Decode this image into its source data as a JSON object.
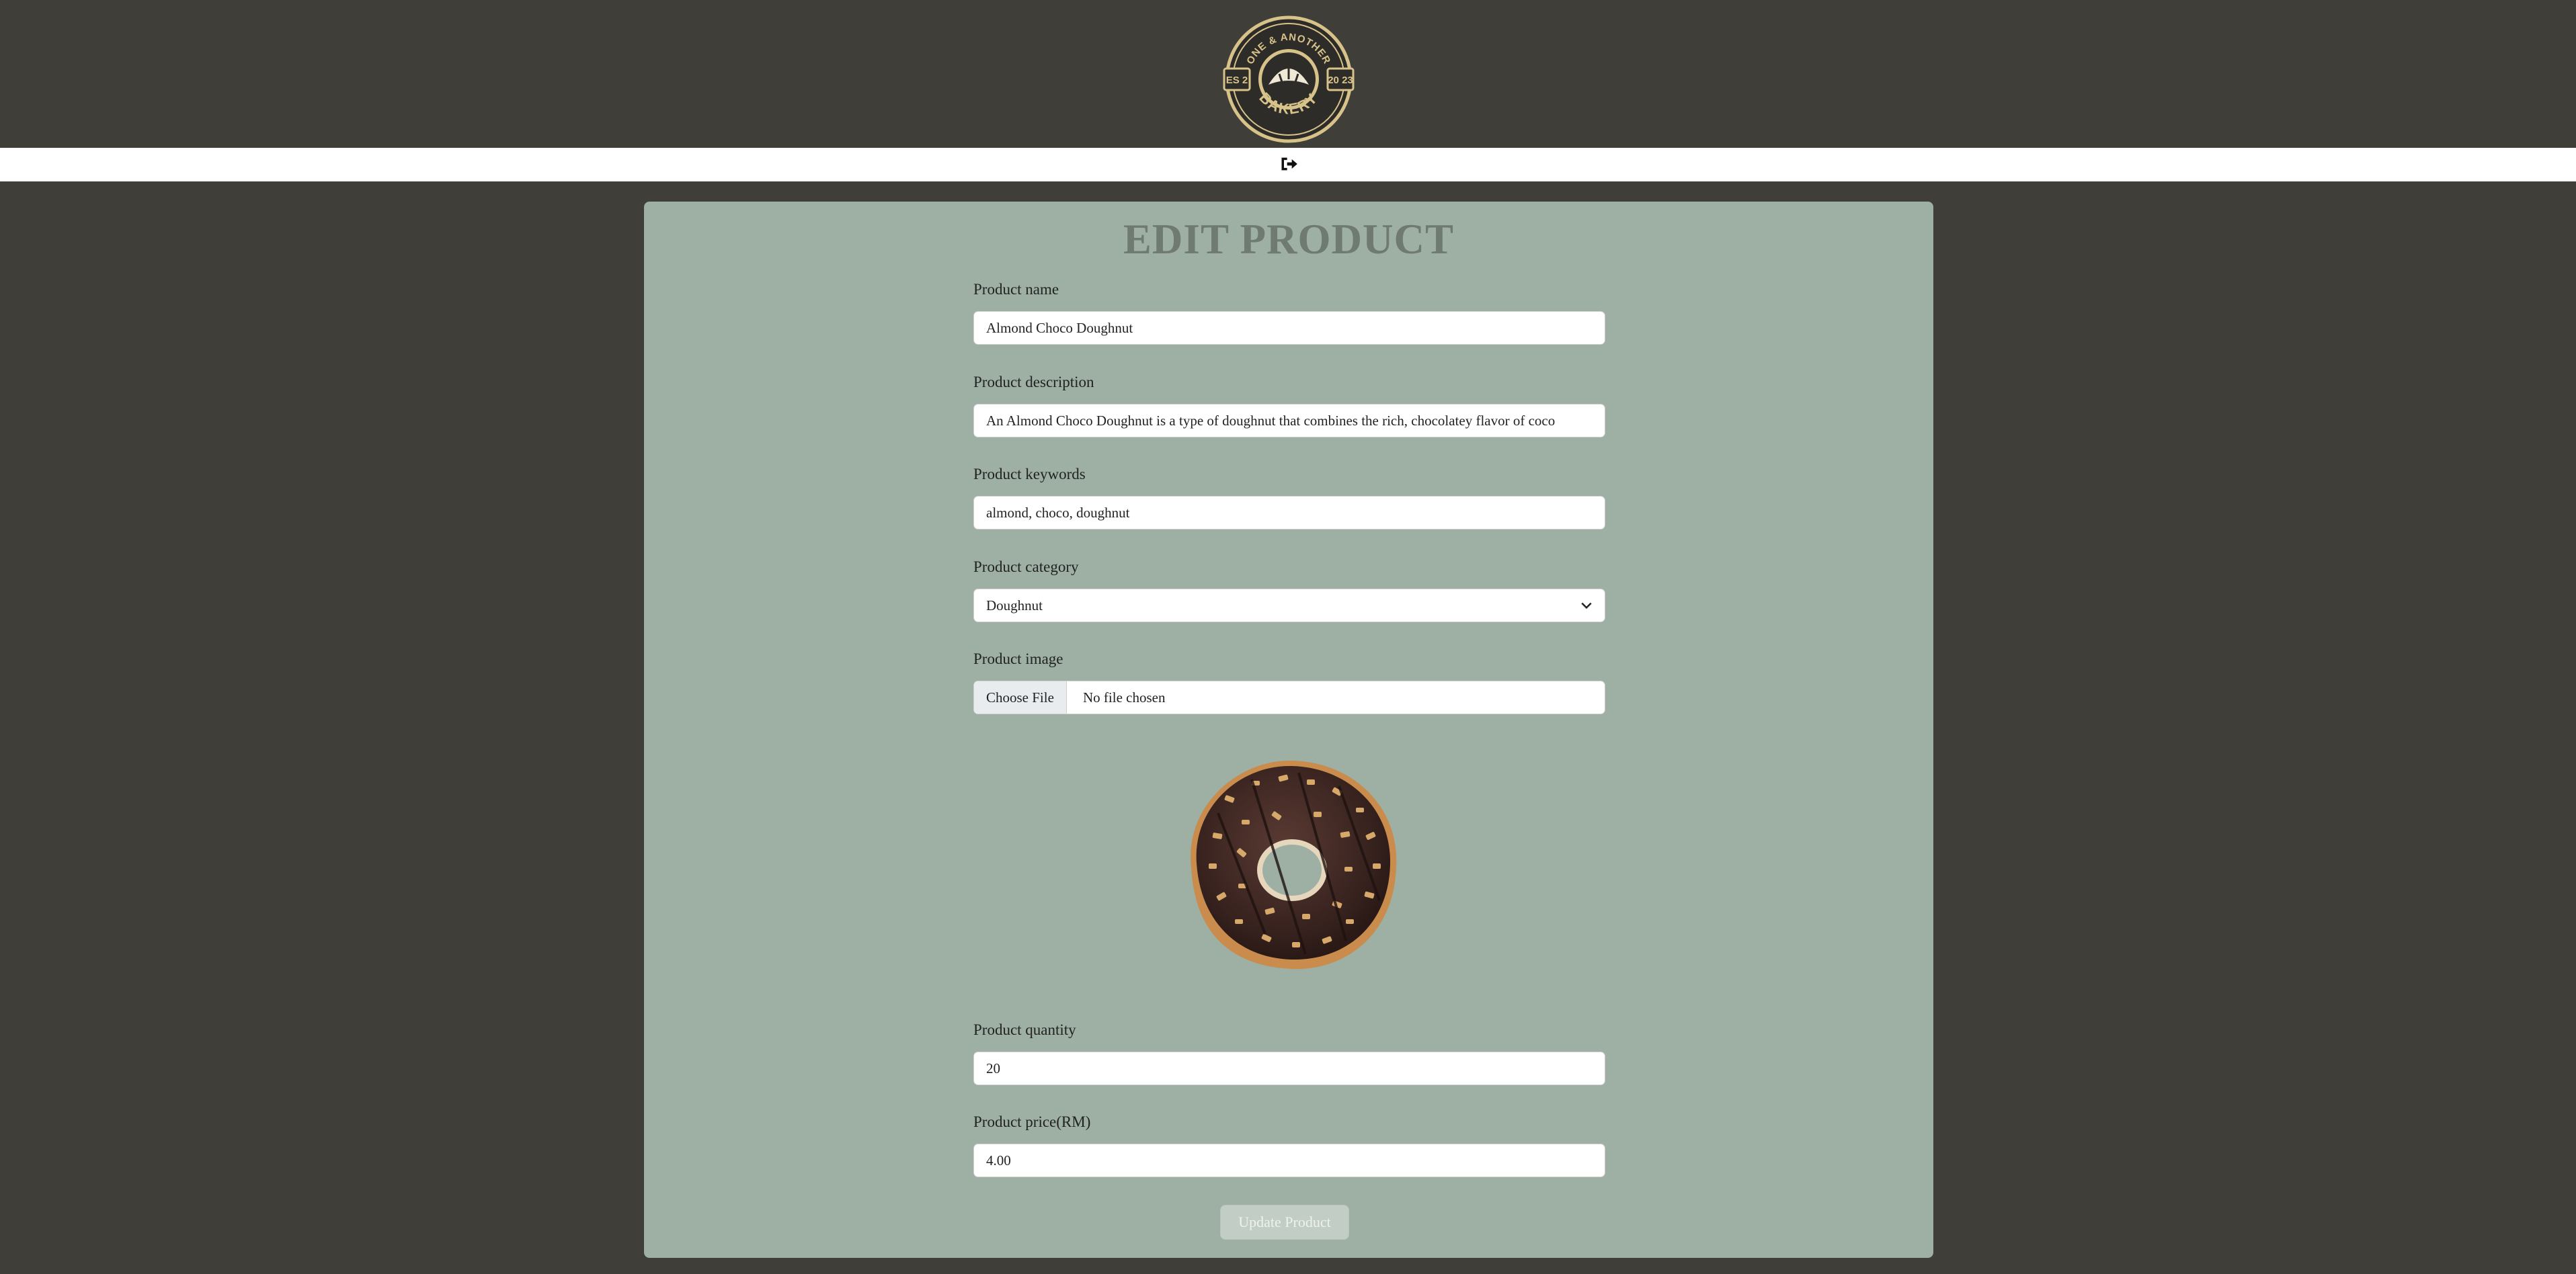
{
  "header": {
    "logo": {
      "top_text": "ONE & ANOTHER",
      "bottom_text": "BAKERY",
      "left_badge": "ES 2",
      "right_badge": "20 23"
    },
    "logout_icon": "sign-out-icon"
  },
  "form": {
    "title": "EDIT PRODUCT",
    "product_name": {
      "label": "Product name",
      "value": "Almond Choco Doughnut"
    },
    "product_description": {
      "label": "Product description",
      "value": "An Almond Choco Doughnut is a type of doughnut that combines the rich, chocolatey flavor of coco"
    },
    "product_keywords": {
      "label": "Product keywords",
      "value": "almond, choco, doughnut"
    },
    "product_category": {
      "label": "Product category",
      "value": "Doughnut"
    },
    "product_image": {
      "label": "Product image",
      "button": "Choose File",
      "status": "No file chosen"
    },
    "product_quantity": {
      "label": "Product quantity",
      "value": "20"
    },
    "product_price": {
      "label": "Product price(RM)",
      "value": "4.00"
    },
    "submit_label": "Update Product"
  },
  "colors": {
    "background": "#403e39",
    "panel": "#9eafa4",
    "title": "#6f7a70",
    "logo_gold": "#d7c38a"
  }
}
